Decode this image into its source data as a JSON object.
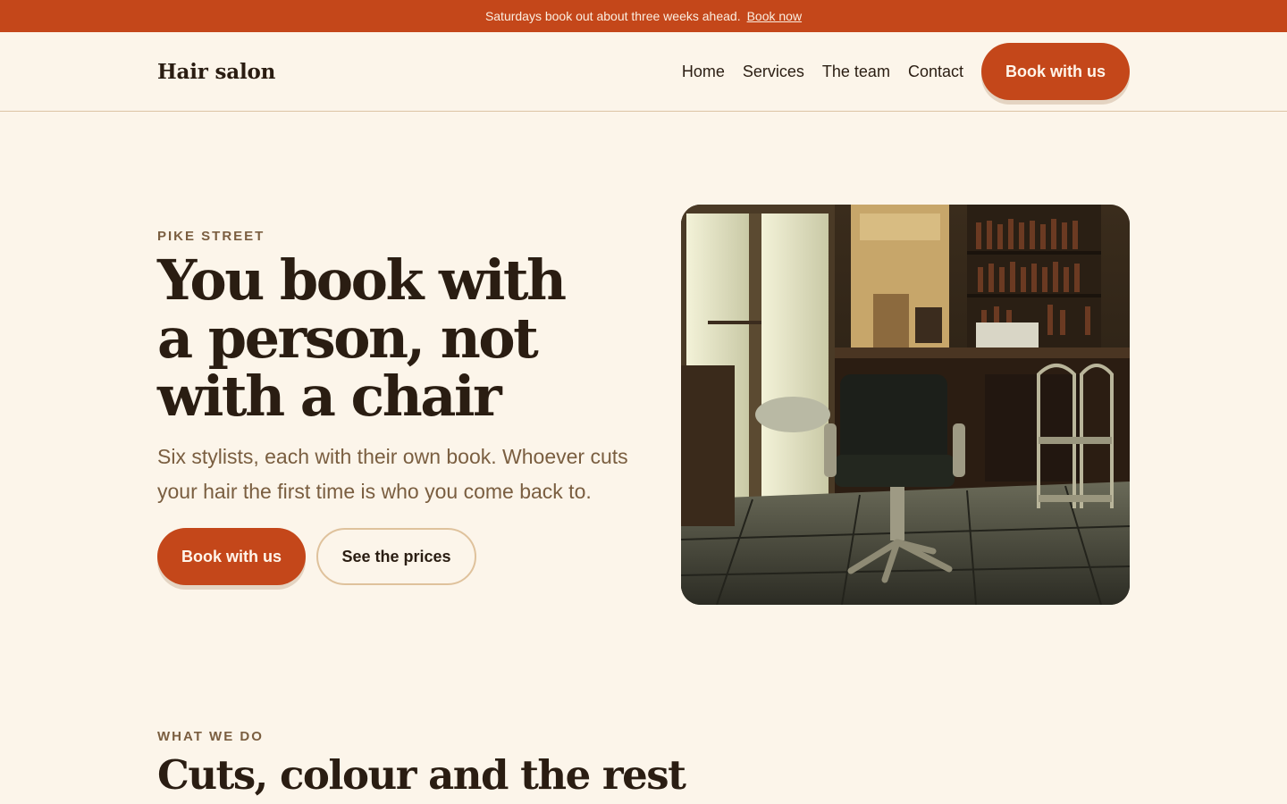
{
  "announcement": {
    "text": "Saturdays book out about three weeks ahead.",
    "link_label": "Book now"
  },
  "nav": {
    "logo": "Hair salon",
    "links": [
      "Home",
      "Services",
      "The team",
      "Contact"
    ],
    "cta_label": "Book with us"
  },
  "hero": {
    "eyebrow": "PIKE STREET",
    "title_lines": [
      "You book with",
      "a person, not",
      "with a chair"
    ],
    "subtitle": "Six stylists, each with their own book. Whoever cuts your hair the first time is who you come back to.",
    "primary_button": "Book with us",
    "secondary_button": "See the prices"
  },
  "section": {
    "eyebrow": "WHAT WE DO",
    "title": "Cuts, colour and the rest"
  },
  "colors": {
    "accent": "#c4471a",
    "background": "#fcf5ea",
    "text": "#2a1d12",
    "muted": "#7a5e40"
  }
}
